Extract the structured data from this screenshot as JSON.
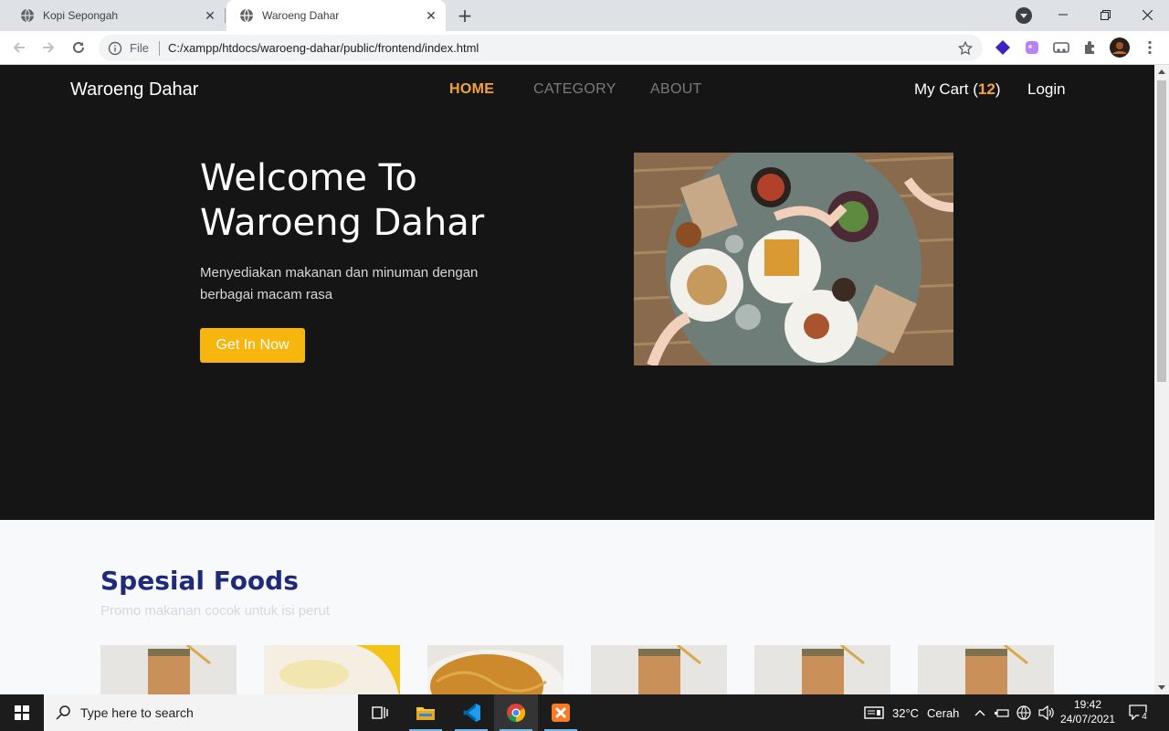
{
  "browser": {
    "tabs": [
      {
        "title": "Kopi Sepongah",
        "active": false
      },
      {
        "title": "Waroeng Dahar",
        "active": true
      }
    ],
    "address": {
      "scheme_label": "File",
      "url": "C:/xampp/htdocs/waroeng-dahar/public/frontend/index.html"
    }
  },
  "site": {
    "brand": "Waroeng Dahar",
    "nav": {
      "home": "HOME",
      "category": "CATEGORY",
      "about": "ABOUT"
    },
    "cart": {
      "label": "My Cart",
      "count": "12"
    },
    "login": "Login",
    "hero": {
      "title": "Welcome To Waroeng Dahar",
      "subtitle": "Menyediakan makanan dan minuman dengan berbagai macam rasa",
      "cta": "Get In Now"
    },
    "section": {
      "title": "Spesial Foods",
      "subtitle": "Promo makanan cocok untuk isi perut"
    }
  },
  "taskbar": {
    "search_placeholder": "Type here to search",
    "weather_temp": "32°C",
    "weather_desc": "Cerah",
    "time": "19:42",
    "date": "24/07/2021",
    "notifications": "4"
  },
  "colors": {
    "accent": "#f3a33a",
    "cta": "#f6b60d",
    "hero_bg": "#161516",
    "section_title": "#1f2a7a"
  }
}
